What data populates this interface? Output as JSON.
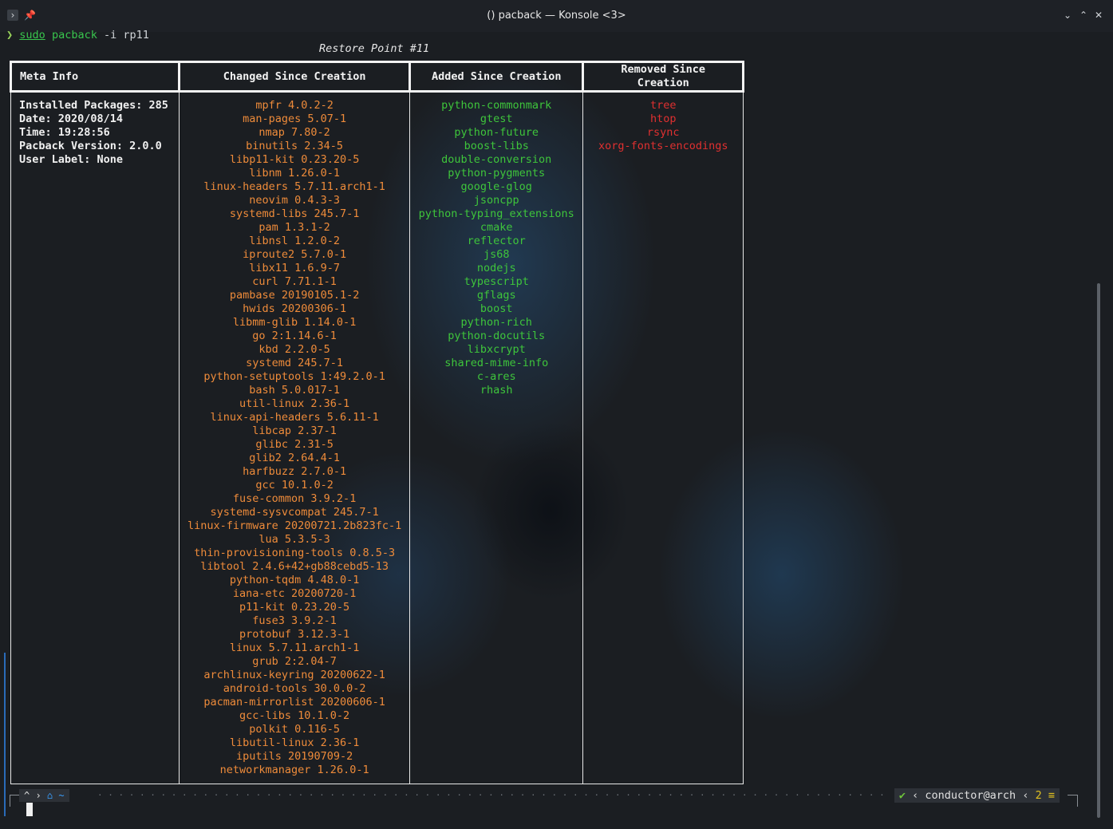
{
  "window": {
    "title": "() pacback — Konsole <3>",
    "icons": [
      "menu-icon",
      "pin-icon",
      "minimize-icon",
      "maximize-icon",
      "close-icon"
    ]
  },
  "prompt": {
    "arrow": "❯",
    "cmd": "sudo",
    "cmd2": "pacback",
    "args": " -i rp11"
  },
  "restore_title": "Restore Point #11",
  "table": {
    "headers": [
      "Meta Info",
      "Changed Since Creation",
      "Added Since Creation",
      "Removed Since Creation"
    ],
    "meta": [
      "Installed Packages: 285",
      "Date: 2020/08/14",
      "Time: 19:28:56",
      "Pacback Version: 2.0.0",
      "User Label: None"
    ],
    "changed": [
      "mpfr 4.0.2-2",
      "man-pages 5.07-1",
      "nmap 7.80-2",
      "binutils 2.34-5",
      "libp11-kit 0.23.20-5",
      "libnm 1.26.0-1",
      "linux-headers 5.7.11.arch1-1",
      "neovim 0.4.3-3",
      "systemd-libs 245.7-1",
      "pam 1.3.1-2",
      "libnsl 1.2.0-2",
      "iproute2 5.7.0-1",
      "libx11 1.6.9-7",
      "curl 7.71.1-1",
      "pambase 20190105.1-2",
      "hwids 20200306-1",
      "libmm-glib 1.14.0-1",
      "go 2:1.14.6-1",
      "kbd 2.2.0-5",
      "systemd 245.7-1",
      "python-setuptools 1:49.2.0-1",
      "bash 5.0.017-1",
      "util-linux 2.36-1",
      "linux-api-headers 5.6.11-1",
      "libcap 2.37-1",
      "glibc 2.31-5",
      "glib2 2.64.4-1",
      "harfbuzz 2.7.0-1",
      "gcc 10.1.0-2",
      "fuse-common 3.9.2-1",
      "systemd-sysvcompat 245.7-1",
      "linux-firmware 20200721.2b823fc-1",
      "lua 5.3.5-3",
      "thin-provisioning-tools 0.8.5-3",
      "libtool 2.4.6+42+gb88cebd5-13",
      "python-tqdm 4.48.0-1",
      "iana-etc 20200720-1",
      "p11-kit 0.23.20-5",
      "fuse3 3.9.2-1",
      "protobuf 3.12.3-1",
      "linux 5.7.11.arch1-1",
      "grub 2:2.04-7",
      "archlinux-keyring 20200622-1",
      "android-tools 30.0.0-2",
      "pacman-mirrorlist 20200606-1",
      "gcc-libs 10.1.0-2",
      "polkit 0.116-5",
      "libutil-linux 2.36-1",
      "iputils 20190709-2",
      "networkmanager 1.26.0-1"
    ],
    "added": [
      "python-commonmark",
      "gtest",
      "python-future",
      "boost-libs",
      "double-conversion",
      "python-pygments",
      "google-glog",
      "jsoncpp",
      "python-typing_extensions",
      "cmake",
      "reflector",
      "js68",
      "nodejs",
      "typescript",
      "gflags",
      "boost",
      "python-rich",
      "python-docutils",
      "libxcrypt",
      "shared-mime-info",
      "c-ares",
      "rhash"
    ],
    "removed": [
      "tree",
      "htop",
      "rsync",
      "xorg-fonts-encodings"
    ]
  },
  "statusbar": {
    "caret": "^",
    "home": "⌂ ~",
    "ok": "✔",
    "user": "conductor@arch",
    "jobs": "2"
  },
  "colors": {
    "changed": "#ee8b3a",
    "added": "#3ec53b",
    "removed": "#e03030",
    "prompt_cmd": "#39c64e"
  }
}
